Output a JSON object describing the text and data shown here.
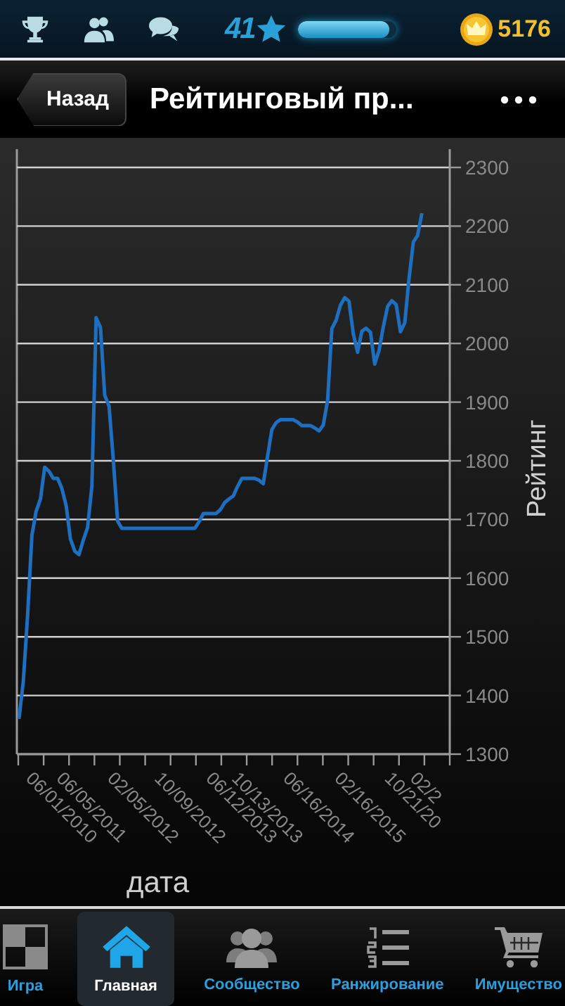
{
  "status_bar": {
    "level_badge": "41",
    "xp": {
      "level": 0.93
    },
    "coins": "5176"
  },
  "nav_bar": {
    "back_button": "Назад",
    "title": "Рейтинговый пр..."
  },
  "chart": {
    "chart_data": {
      "type": "line",
      "grid": true,
      "xlabel": "дата",
      "ylabel": "Рейтинг",
      "ylim": [
        1300,
        2300
      ],
      "yticks": [
        1300,
        1400,
        1500,
        1600,
        1700,
        1800,
        1900,
        2000,
        2100,
        2200,
        2300
      ],
      "categories": [
        null,
        null,
        null,
        null,
        null,
        null,
        null,
        null,
        null,
        null,
        "06/01/2010",
        null,
        null,
        null,
        null,
        null,
        null,
        "06/05/2011",
        null,
        null,
        null,
        null,
        null,
        null,
        null,
        null,
        null,
        null,
        null,
        "02/05/2012",
        null,
        null,
        null,
        null,
        null,
        null,
        null,
        null,
        null,
        null,
        "10/09/2012",
        null,
        null,
        null,
        null,
        null,
        null,
        null,
        null,
        null,
        null,
        null,
        "06/12/2013",
        null,
        null,
        null,
        null,
        null,
        "10/13/2013",
        null,
        null,
        null,
        null,
        null,
        null,
        null,
        null,
        null,
        null,
        null,
        "06/16/2014",
        null,
        null,
        null,
        null,
        null,
        null,
        null,
        null,
        null,
        null,
        null,
        "02/16/2015",
        null,
        null,
        null,
        null,
        null,
        null,
        null,
        null,
        null,
        "10/21/20",
        null,
        null,
        "02/2",
        null,
        null,
        null,
        null,
        null
      ],
      "series": [
        {
          "color": "#1e6fc0",
          "values": [
            1360,
            1425,
            1535,
            1673,
            1714,
            1735,
            1789,
            1782,
            1770,
            1770,
            1753,
            1723,
            1667,
            1646,
            1640,
            1665,
            1686,
            1757,
            2044,
            2027,
            1912,
            1893,
            1802,
            1697,
            1685,
            1685,
            1685,
            1685,
            1685,
            1685,
            1685,
            1685,
            1685,
            1685,
            1685,
            1685,
            1685,
            1685,
            1685,
            1685,
            1685,
            1685,
            1696,
            1710,
            1710,
            1710,
            1710,
            1717,
            1729,
            1735,
            1740,
            1756,
            1770,
            1770,
            1770,
            1770,
            1767,
            1761,
            1808,
            1853,
            1865,
            1870,
            1870,
            1870,
            1870,
            1866,
            1860,
            1860,
            1860,
            1856,
            1851,
            1861,
            1903,
            2025,
            2040,
            2065,
            2078,
            2072,
            2016,
            1985,
            2021,
            2026,
            2019,
            1965,
            1988,
            2028,
            2063,
            2073,
            2066,
            2020,
            2035,
            2110,
            2173,
            2184,
            2222,
            null,
            null,
            null,
            null,
            null,
            null
          ]
        }
      ]
    }
  },
  "tab_bar": [
    {
      "kind": "board",
      "label": "Игра",
      "selected": false
    },
    {
      "kind": "home",
      "label": "Главная",
      "selected": true
    },
    {
      "kind": "community",
      "label": "Сообщество",
      "selected": false
    },
    {
      "kind": "ranking",
      "label": "Ранжирование",
      "selected": false
    },
    {
      "kind": "cart",
      "label": "Имущество",
      "selected": false
    }
  ]
}
